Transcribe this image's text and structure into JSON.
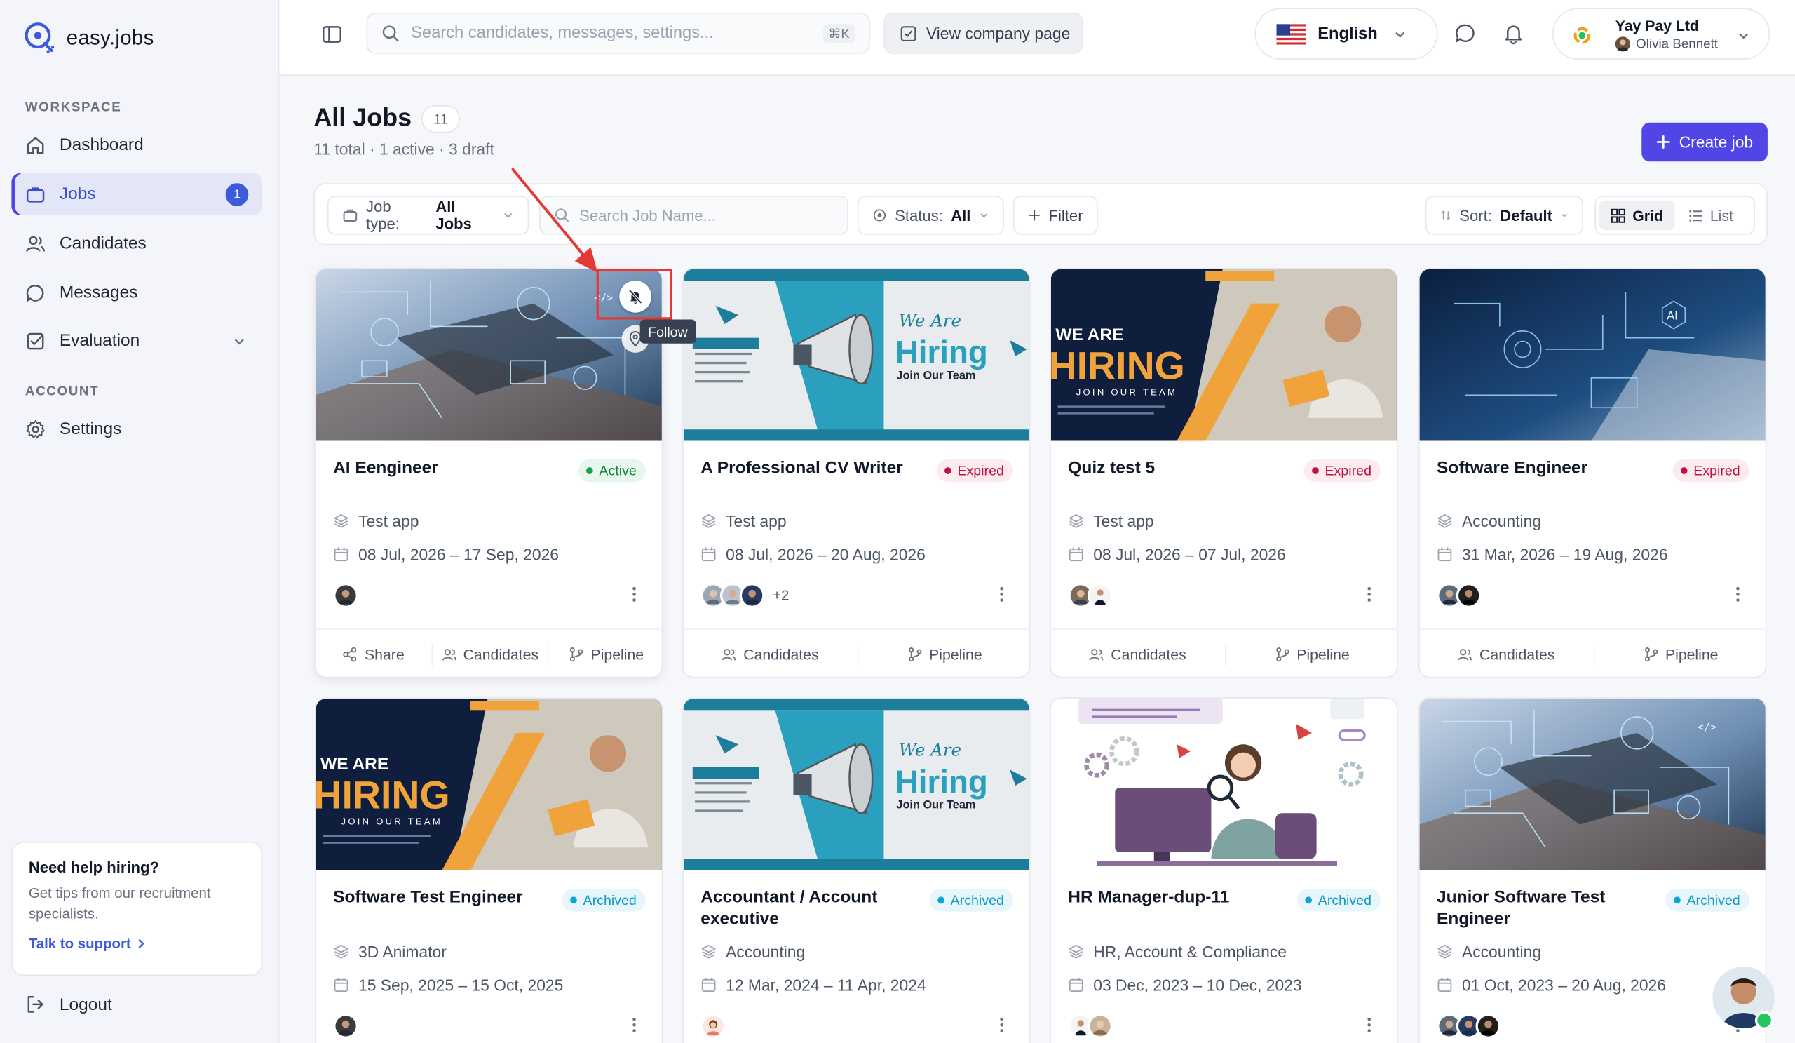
{
  "brand": {
    "name": "easy.jobs"
  },
  "sidebar": {
    "workspace_label": "WORKSPACE",
    "account_label": "ACCOUNT",
    "items": [
      {
        "label": "Dashboard"
      },
      {
        "label": "Jobs",
        "badge": "1"
      },
      {
        "label": "Candidates"
      },
      {
        "label": "Messages"
      },
      {
        "label": "Evaluation"
      },
      {
        "label": "Settings"
      }
    ],
    "help": {
      "title": "Need help hiring?",
      "text": "Get tips from our recruitment specialists.",
      "link": "Talk to support"
    },
    "logout": "Logout"
  },
  "topbar": {
    "search_placeholder": "Search candidates, messages, settings...",
    "shortcut": "⌘K",
    "view_company": "View company page",
    "language": "English",
    "company": "Yay Pay Ltd",
    "user": "Olivia Bennett"
  },
  "page": {
    "title": "All Jobs",
    "count": "11",
    "subtitle": "11 total · 1 active · 3 draft",
    "create_label": "Create job"
  },
  "filters": {
    "job_type_label": "Job type:",
    "job_type_value": "All Jobs",
    "search_placeholder": "Search Job Name...",
    "status_label": "Status:",
    "status_value": "All",
    "filter_label": "Filter",
    "sort_label": "Sort:",
    "sort_value": "Default",
    "grid_label": "Grid",
    "list_label": "List"
  },
  "tooltip": {
    "follow": "Follow"
  },
  "jobs": [
    {
      "title": "AI Eengineer",
      "status": "Active",
      "category": "Test app",
      "dates": "08 Jul, 2026 – 17 Sep, 2026",
      "more": "",
      "actions": [
        "Share",
        "Candidates",
        "Pipeline"
      ]
    },
    {
      "title": "A Professional CV Writer",
      "status": "Expired",
      "category": "Test app",
      "dates": "08 Jul, 2026 – 20 Aug, 2026",
      "more": "+2",
      "actions": [
        "Candidates",
        "Pipeline"
      ]
    },
    {
      "title": "Quiz test 5",
      "status": "Expired",
      "category": "Test app",
      "dates": "08 Jul, 2026 – 07 Jul, 2026",
      "more": "",
      "actions": [
        "Candidates",
        "Pipeline"
      ]
    },
    {
      "title": "Software Engineer",
      "status": "Expired",
      "category": "Accounting",
      "dates": "31 Mar, 2026 – 19 Aug, 2026",
      "more": "",
      "actions": [
        "Candidates",
        "Pipeline"
      ]
    },
    {
      "title": "Software Test Engineer",
      "status": "Archived",
      "category": "3D Animator",
      "dates": "15 Sep, 2025 – 15 Oct, 2025",
      "more": ""
    },
    {
      "title": "Accountant / Account executive",
      "status": "Archived",
      "category": "Accounting",
      "dates": "12 Mar, 2024 – 11 Apr, 2024",
      "more": ""
    },
    {
      "title": "HR Manager-dup-11",
      "status": "Archived",
      "category": "HR, Account & Compliance",
      "dates": "03 Dec, 2023 – 10 Dec, 2023",
      "more": ""
    },
    {
      "title": "Junior Software Test Engineer",
      "status": "Archived",
      "category": "Accounting",
      "dates": "01 Oct, 2023 – 20 Aug, 2026",
      "more": ""
    }
  ],
  "banners": {
    "hiring_text": "Hiring",
    "we_are": "We Are",
    "join_team": "Join Our Team",
    "we_are_caps": "WE ARE",
    "hiring_caps": "HIRING",
    "join_caps": "JOIN OUR TEAM",
    "ai_label": "AI"
  },
  "colors": {
    "accent": "#4f46e5",
    "active": "#16a34a",
    "expired": "#be123c",
    "archived": "#0ea5d4"
  }
}
